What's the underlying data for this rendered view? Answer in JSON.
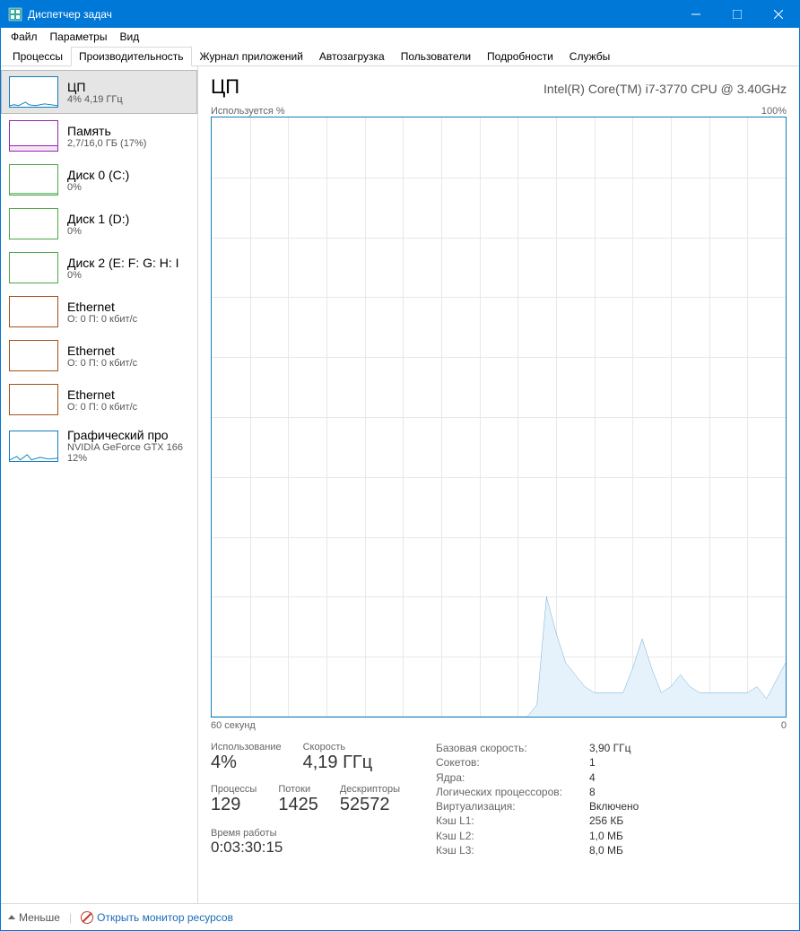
{
  "titlebar": {
    "title": "Диспетчер задач"
  },
  "menubar": {
    "items": [
      "Файл",
      "Параметры",
      "Вид"
    ]
  },
  "tabs": {
    "items": [
      "Процессы",
      "Производительность",
      "Журнал приложений",
      "Автозагрузка",
      "Пользователи",
      "Подробности",
      "Службы"
    ],
    "active": 1
  },
  "sidebar": {
    "items": [
      {
        "title": "ЦП",
        "sub": "4% 4,19 ГГц",
        "color": "cpu"
      },
      {
        "title": "Память",
        "sub": "2,7/16,0 ГБ (17%)",
        "color": "mem"
      },
      {
        "title": "Диск 0 (C:)",
        "sub": "0%",
        "color": "disk"
      },
      {
        "title": "Диск 1 (D:)",
        "sub": "0%",
        "color": "disk"
      },
      {
        "title": "Диск 2 (E: F: G: H: I",
        "sub": "0%",
        "color": "disk"
      },
      {
        "title": "Ethernet",
        "sub": "О: 0 П: 0 кбит/с",
        "color": "net"
      },
      {
        "title": "Ethernet",
        "sub": "О: 0 П: 0 кбит/с",
        "color": "net"
      },
      {
        "title": "Ethernet",
        "sub": "О: 0 П: 0 кбит/с",
        "color": "net"
      },
      {
        "title": "Графический про",
        "sub": "NVIDIA GeForce GTX 166",
        "sub2": "12%",
        "color": "cpu"
      }
    ],
    "selected": 0
  },
  "detail": {
    "title": "ЦП",
    "subtitle": "Intel(R) Core(TM) i7-3770 CPU @ 3.40GHz",
    "utilLabel": "Используется %",
    "utilMax": "100%",
    "xLeft": "60 секунд",
    "xRight": "0",
    "stats": {
      "usage_label": "Использование",
      "usage": "4%",
      "speed_label": "Скорость",
      "speed": "4,19 ГГц",
      "proc_label": "Процессы",
      "proc": "129",
      "threads_label": "Потоки",
      "threads": "1425",
      "handles_label": "Дескрипторы",
      "handles": "52572",
      "uptime_label": "Время работы",
      "uptime": "0:03:30:15"
    },
    "info": {
      "k0": "Базовая скорость:",
      "v0": "3,90 ГГц",
      "k1": "Сокетов:",
      "v1": "1",
      "k2": "Ядра:",
      "v2": "4",
      "k3": "Логических процессоров:",
      "v3": "8",
      "k4": "Виртуализация:",
      "v4": "Включено",
      "k5": "Кэш L1:",
      "v5": "256 КБ",
      "k6": "Кэш L2:",
      "v6": "1,0 МБ",
      "k7": "Кэш L3:",
      "v7": "8,0 МБ"
    }
  },
  "footer": {
    "less": "Меньше",
    "resmon": "Открыть монитор ресурсов"
  },
  "chart_data": {
    "type": "line",
    "title": "ЦП — Используется %",
    "xlabel": "секунд",
    "x_range": [
      60,
      0
    ],
    "ylabel": "%",
    "ylim": [
      0,
      100
    ],
    "series": [
      {
        "name": "CPU %",
        "x": [
          60,
          58,
          56,
          54,
          52,
          50,
          48,
          46,
          44,
          42,
          40,
          38,
          36,
          34,
          32,
          30,
          28,
          27,
          26,
          25,
          24,
          23,
          22,
          21,
          20,
          19,
          18,
          17,
          16,
          15,
          14,
          13,
          12,
          11,
          10,
          9,
          8,
          7,
          6,
          5,
          4,
          3,
          2,
          1,
          0
        ],
        "values": [
          0,
          0,
          0,
          0,
          0,
          0,
          0,
          0,
          0,
          0,
          0,
          0,
          0,
          0,
          0,
          0,
          0,
          0,
          2,
          20,
          14,
          9,
          7,
          5,
          4,
          4,
          4,
          4,
          8,
          13,
          8,
          4,
          5,
          7,
          5,
          4,
          4,
          4,
          4,
          4,
          4,
          5,
          3,
          6,
          9
        ]
      }
    ]
  }
}
